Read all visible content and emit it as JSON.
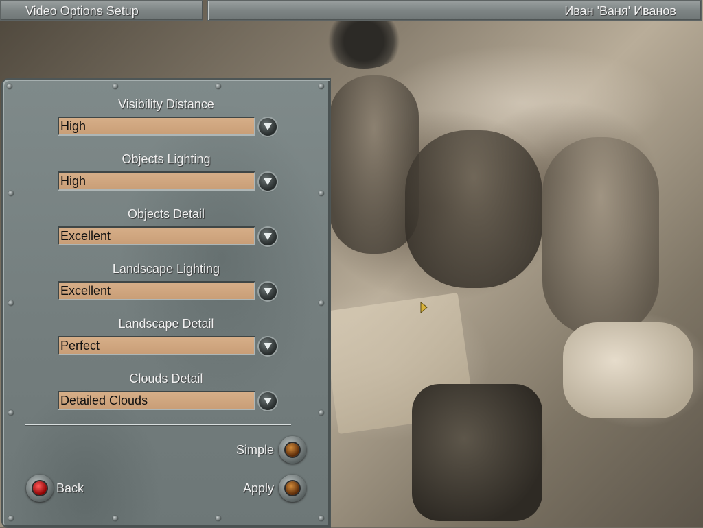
{
  "header": {
    "title": "Video Options Setup",
    "player_name": "Иван 'Ваня' Иванов"
  },
  "options": [
    {
      "label": "Visibility Distance",
      "value": "High"
    },
    {
      "label": "Objects Lighting",
      "value": "High"
    },
    {
      "label": "Objects Detail",
      "value": "Excellent"
    },
    {
      "label": "Landscape Lighting",
      "value": "Excellent"
    },
    {
      "label": "Landscape Detail",
      "value": "Perfect"
    },
    {
      "label": "Clouds Detail",
      "value": "Detailed Clouds"
    }
  ],
  "buttons": {
    "simple": "Simple",
    "back": "Back",
    "apply": "Apply"
  },
  "icons": {
    "dropdown": "chevron-down-icon",
    "cursor": "arrow-cursor-icon"
  },
  "colors": {
    "field_bg": "#d0a67f",
    "panel": "#778181",
    "lamp_amber": "#b36a22",
    "lamp_red": "#e01010"
  }
}
